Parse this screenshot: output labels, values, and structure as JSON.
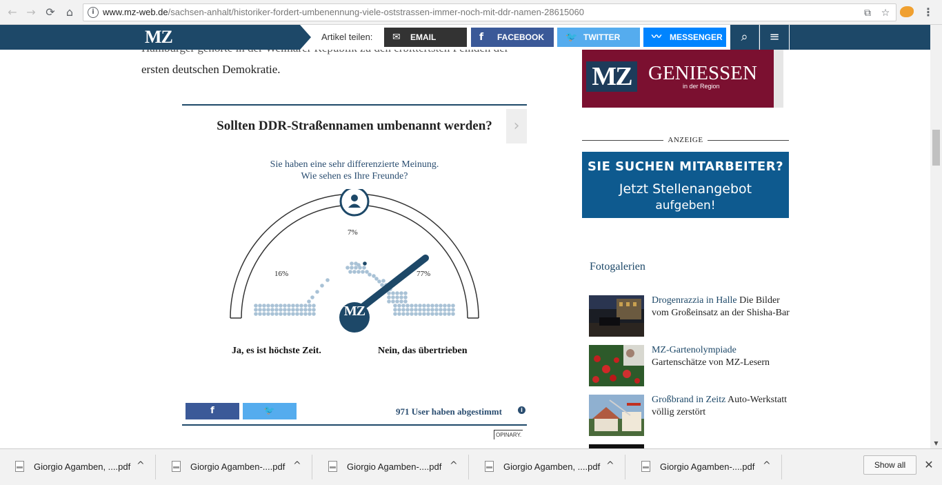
{
  "browser": {
    "url_domain": "www.mz-web.de",
    "url_path": "/sachsen-anhalt/historiker-fordert-umbenennung-viele-oststrassen-immer-noch-mit-ddr-namen-28615060",
    "back_icon": "←",
    "forward_icon": "→",
    "reload_icon": "⟳",
    "home_icon": "⌂",
    "translate_icon": "⧉",
    "star_icon": "☆",
    "menu_icon": "⋮"
  },
  "mzbar": {
    "logo": "MZ",
    "share_label": "Artikel teilen:",
    "buttons": [
      {
        "label": "EMAIL",
        "icon": "✉",
        "color": "#333333"
      },
      {
        "label": "FACEBOOK",
        "icon": "f",
        "color": "#3b5998"
      },
      {
        "label": "TWITTER",
        "icon": "🐦",
        "color": "#55acee"
      },
      {
        "label": "MESSENGER",
        "icon": "〰",
        "color": "#0084ff"
      }
    ],
    "search_icon": "⌕",
    "menu_icon": "≡"
  },
  "article": {
    "line_partial": "Hamburger gehörte in der Weimarer Republik zu den erbittertsten Feinden der",
    "line_2": "ersten deutschen Demokratie."
  },
  "poll": {
    "title": "Sollten DDR-Straßennamen umbenannt werden?",
    "subtitle_1": "Sie haben eine sehr differenzierte Meinung.",
    "subtitle_2": "Wie sehen es Ihre Freunde?",
    "pct_left": "16%",
    "pct_mid": "7%",
    "pct_right": "77%",
    "label_left": "Ja, es ist höchste Zeit.",
    "label_right": "Nein, das übertrieben",
    "gauge_logo": "MZ",
    "next_icon": "›",
    "share_fb": "f",
    "share_tw": "🐦",
    "votes": "971 User haben abgestimmt",
    "info_icon": "i",
    "footer": "OPINARY."
  },
  "sidebar": {
    "ad_top": {
      "mz": "MZ",
      "title": "GENIESSEN",
      "sub": "in der Region"
    },
    "anzeige": "ANZEIGE",
    "ad_jobs": {
      "line1": "SIE SUCHEN MITARBEITER?",
      "line2": "Jetzt Stellenangebot",
      "line3": "aufgeben!"
    },
    "fotogalerien": "Fotogalerien",
    "galleries": [
      {
        "highlight": "Drogenrazzia in Halle",
        "rest": " Die Bilder vom Großeinsatz an der Shisha-Bar"
      },
      {
        "highlight": "MZ-Gartenolympiade",
        "rest": " Gartenschätze von MZ-Lesern"
      },
      {
        "highlight": "Großbrand in Zeitz",
        "rest": " Auto-Werkstatt völlig zerstört"
      }
    ]
  },
  "downloads": {
    "items": [
      {
        "name": "Giorgio Agamben, ....pdf"
      },
      {
        "name": "Giorgio Agamben-....pdf"
      },
      {
        "name": "Giorgio Agamben-....pdf"
      },
      {
        "name": "Giorgio Agamben, ....pdf"
      },
      {
        "name": "Giorgio Agamben-....pdf"
      }
    ],
    "chevron": "^",
    "show_all": "Show all",
    "close_icon": "✕"
  }
}
